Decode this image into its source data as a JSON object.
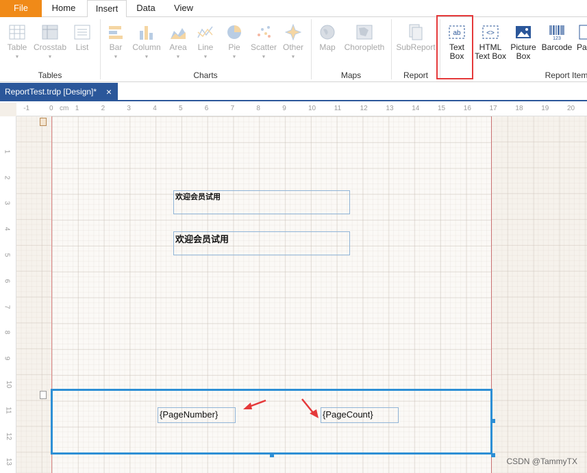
{
  "ribbon_tabs": [
    {
      "label": "File",
      "state": "file"
    },
    {
      "label": "Home",
      "state": "normal"
    },
    {
      "label": "Insert",
      "state": "active"
    },
    {
      "label": "Data",
      "state": "normal"
    },
    {
      "label": "View",
      "state": "normal"
    }
  ],
  "groups": {
    "tables": {
      "label": "Tables",
      "items": [
        "Table",
        "Crosstab",
        "List"
      ]
    },
    "charts": {
      "label": "Charts",
      "items": [
        "Bar",
        "Column",
        "Area",
        "Line",
        "Pie",
        "Scatter",
        "Other"
      ]
    },
    "maps": {
      "label": "Maps",
      "items": [
        "Map",
        "Choropleth"
      ]
    },
    "report": {
      "label": "Report",
      "items": [
        "SubReport"
      ]
    },
    "report_items": {
      "label": "Report Items",
      "items": [
        {
          "line1": "Text",
          "line2": "Box"
        },
        {
          "line1": "HTML",
          "line2": "Text Box"
        },
        {
          "line1": "Picture",
          "line2": "Box"
        },
        {
          "line1": "Barcode",
          "line2": ""
        },
        {
          "line1": "Pa",
          "line2": ""
        }
      ]
    }
  },
  "document_tab": {
    "title": "ReportTest.trdp [Design]*",
    "close": "×"
  },
  "ruler": {
    "unit": "cm",
    "h_ticks": [
      "-1",
      "0",
      "1",
      "2",
      "3",
      "4",
      "5",
      "6",
      "7",
      "8",
      "9",
      "10",
      "11",
      "12",
      "13",
      "14",
      "15",
      "16",
      "17",
      "18",
      "19",
      "20"
    ],
    "v_ticks": [
      "1",
      "2",
      "3",
      "4",
      "5",
      "6",
      "7",
      "8",
      "9",
      "10",
      "11",
      "12",
      "13"
    ]
  },
  "textboxes": {
    "tb1": "欢迎会员试用",
    "tb2": "欢迎会员试用",
    "page_number": "{PageNumber}",
    "page_count": "{PageCount}"
  },
  "watermark": "CSDN @TammyTX",
  "colors": {
    "file_tab": "#f08a18",
    "doc_tab": "#2b579a",
    "selection": "#2d8fd5",
    "highlight": "#e5393a"
  }
}
